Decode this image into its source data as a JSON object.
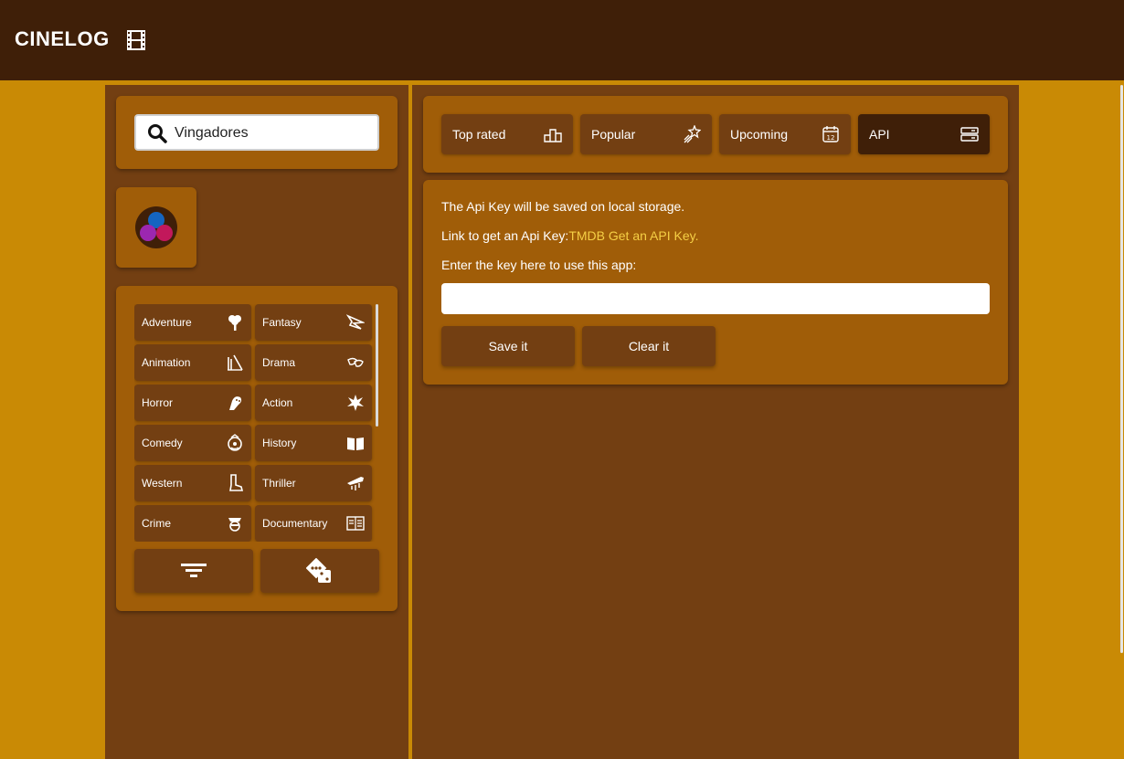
{
  "header": {
    "brand": "CINELOG",
    "icon": "film-icon"
  },
  "search": {
    "value": "Vingadores",
    "icon": "search-icon"
  },
  "logo": {
    "icon": "tmdb-logo",
    "colors": [
      "#1565c0",
      "#9c27b0",
      "#c2185b"
    ]
  },
  "genres": [
    {
      "label": "Adventure",
      "icon": "tree-icon"
    },
    {
      "label": "Fantasy",
      "icon": "dragon-icon"
    },
    {
      "label": "Animation",
      "icon": "pencil-ruler-icon"
    },
    {
      "label": "Drama",
      "icon": "masks-icon"
    },
    {
      "label": "Horror",
      "icon": "ghost-icon"
    },
    {
      "label": "Action",
      "icon": "explosion-icon"
    },
    {
      "label": "Comedy",
      "icon": "clown-icon"
    },
    {
      "label": "History",
      "icon": "book-icon"
    },
    {
      "label": "Western",
      "icon": "cowboy-boot-icon"
    },
    {
      "label": "Thriller",
      "icon": "knife-icon"
    },
    {
      "label": "Crime",
      "icon": "mask-icon"
    },
    {
      "label": "Documentary",
      "icon": "open-book-icon"
    }
  ],
  "actions": {
    "filter_icon": "filter-icon",
    "random_icon": "dice-icon"
  },
  "tabs": [
    {
      "label": "Top rated",
      "icon": "podium-icon"
    },
    {
      "label": "Popular",
      "icon": "stars-icon"
    },
    {
      "label": "Upcoming",
      "icon": "calendar-icon"
    },
    {
      "label": "API",
      "icon": "server-icon",
      "active": true
    }
  ],
  "api": {
    "line1": "The Api Key will be saved on local storage.",
    "line2_prefix": "Link to get an Api Key:",
    "line2_link": "TMDB Get an API Key.",
    "line3": "Enter the key here to use this app:",
    "input_value": "",
    "save_label": "Save it",
    "clear_label": "Clear it"
  },
  "colors": {
    "background": "#c98a05",
    "header": "#3f1f08",
    "panel": "#733f12",
    "card": "#a05d08",
    "link": "#f5cf45"
  }
}
